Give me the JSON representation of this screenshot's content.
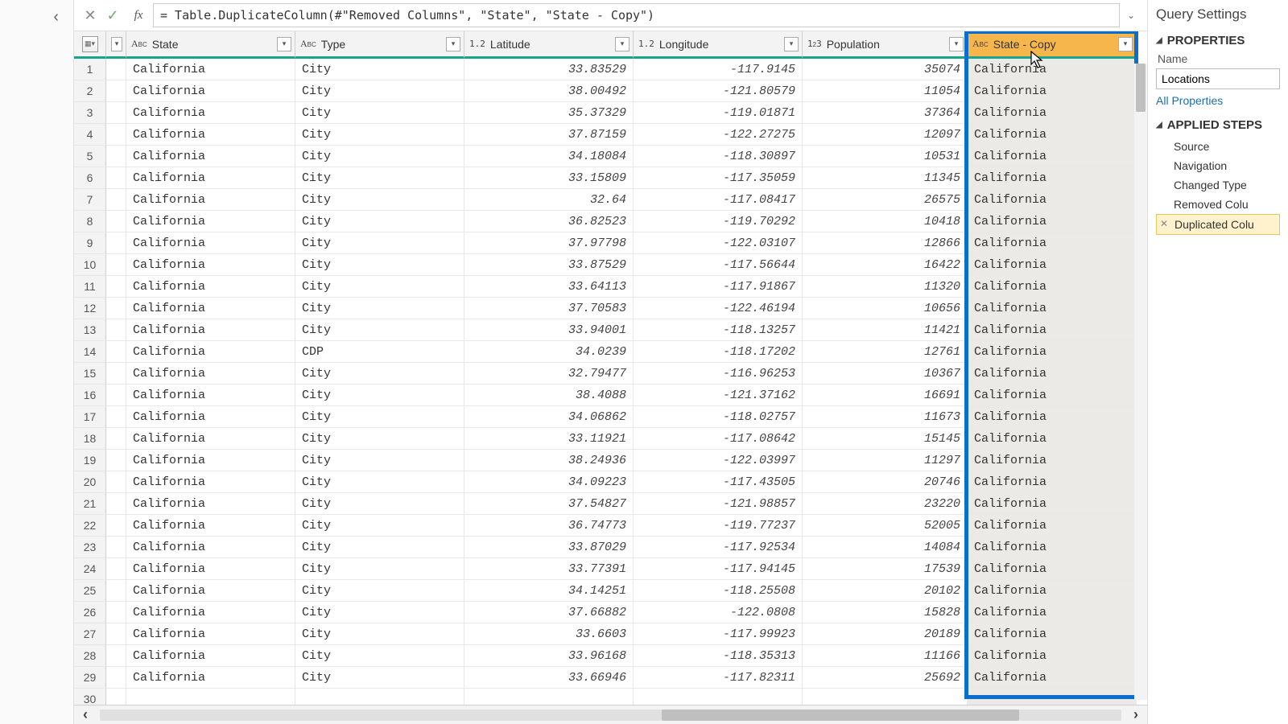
{
  "formula_bar": {
    "formula": "= Table.DuplicateColumn(#\"Removed Columns\", \"State\", \"State - Copy\")"
  },
  "columns": [
    {
      "name": "State",
      "type": "text",
      "sel": false
    },
    {
      "name": "Type",
      "type": "text",
      "sel": false
    },
    {
      "name": "Latitude",
      "type": "dec",
      "sel": false
    },
    {
      "name": "Longitude",
      "type": "dec",
      "sel": false
    },
    {
      "name": "Population",
      "type": "int",
      "sel": false
    },
    {
      "name": "State - Copy",
      "type": "text",
      "sel": true
    }
  ],
  "rows": [
    {
      "n": 1,
      "state": "California",
      "type": "City",
      "lat": "33.83529",
      "lon": "-117.9145",
      "pop": "35074",
      "copy": "California"
    },
    {
      "n": 2,
      "state": "California",
      "type": "City",
      "lat": "38.00492",
      "lon": "-121.80579",
      "pop": "11054",
      "copy": "California"
    },
    {
      "n": 3,
      "state": "California",
      "type": "City",
      "lat": "35.37329",
      "lon": "-119.01871",
      "pop": "37364",
      "copy": "California"
    },
    {
      "n": 4,
      "state": "California",
      "type": "City",
      "lat": "37.87159",
      "lon": "-122.27275",
      "pop": "12097",
      "copy": "California"
    },
    {
      "n": 5,
      "state": "California",
      "type": "City",
      "lat": "34.18084",
      "lon": "-118.30897",
      "pop": "10531",
      "copy": "California"
    },
    {
      "n": 6,
      "state": "California",
      "type": "City",
      "lat": "33.15809",
      "lon": "-117.35059",
      "pop": "11345",
      "copy": "California"
    },
    {
      "n": 7,
      "state": "California",
      "type": "City",
      "lat": "32.64",
      "lon": "-117.08417",
      "pop": "26575",
      "copy": "California"
    },
    {
      "n": 8,
      "state": "California",
      "type": "City",
      "lat": "36.82523",
      "lon": "-119.70292",
      "pop": "10418",
      "copy": "California"
    },
    {
      "n": 9,
      "state": "California",
      "type": "City",
      "lat": "37.97798",
      "lon": "-122.03107",
      "pop": "12866",
      "copy": "California"
    },
    {
      "n": 10,
      "state": "California",
      "type": "City",
      "lat": "33.87529",
      "lon": "-117.56644",
      "pop": "16422",
      "copy": "California"
    },
    {
      "n": 11,
      "state": "California",
      "type": "City",
      "lat": "33.64113",
      "lon": "-117.91867",
      "pop": "11320",
      "copy": "California"
    },
    {
      "n": 12,
      "state": "California",
      "type": "City",
      "lat": "37.70583",
      "lon": "-122.46194",
      "pop": "10656",
      "copy": "California"
    },
    {
      "n": 13,
      "state": "California",
      "type": "City",
      "lat": "33.94001",
      "lon": "-118.13257",
      "pop": "11421",
      "copy": "California"
    },
    {
      "n": 14,
      "state": "California",
      "type": "CDP",
      "lat": "34.0239",
      "lon": "-118.17202",
      "pop": "12761",
      "copy": "California"
    },
    {
      "n": 15,
      "state": "California",
      "type": "City",
      "lat": "32.79477",
      "lon": "-116.96253",
      "pop": "10367",
      "copy": "California"
    },
    {
      "n": 16,
      "state": "California",
      "type": "City",
      "lat": "38.4088",
      "lon": "-121.37162",
      "pop": "16691",
      "copy": "California"
    },
    {
      "n": 17,
      "state": "California",
      "type": "City",
      "lat": "34.06862",
      "lon": "-118.02757",
      "pop": "11673",
      "copy": "California"
    },
    {
      "n": 18,
      "state": "California",
      "type": "City",
      "lat": "33.11921",
      "lon": "-117.08642",
      "pop": "15145",
      "copy": "California"
    },
    {
      "n": 19,
      "state": "California",
      "type": "City",
      "lat": "38.24936",
      "lon": "-122.03997",
      "pop": "11297",
      "copy": "California"
    },
    {
      "n": 20,
      "state": "California",
      "type": "City",
      "lat": "34.09223",
      "lon": "-117.43505",
      "pop": "20746",
      "copy": "California"
    },
    {
      "n": 21,
      "state": "California",
      "type": "City",
      "lat": "37.54827",
      "lon": "-121.98857",
      "pop": "23220",
      "copy": "California"
    },
    {
      "n": 22,
      "state": "California",
      "type": "City",
      "lat": "36.74773",
      "lon": "-119.77237",
      "pop": "52005",
      "copy": "California"
    },
    {
      "n": 23,
      "state": "California",
      "type": "City",
      "lat": "33.87029",
      "lon": "-117.92534",
      "pop": "14084",
      "copy": "California"
    },
    {
      "n": 24,
      "state": "California",
      "type": "City",
      "lat": "33.77391",
      "lon": "-117.94145",
      "pop": "17539",
      "copy": "California"
    },
    {
      "n": 25,
      "state": "California",
      "type": "City",
      "lat": "34.14251",
      "lon": "-118.25508",
      "pop": "20102",
      "copy": "California"
    },
    {
      "n": 26,
      "state": "California",
      "type": "City",
      "lat": "37.66882",
      "lon": "-122.0808",
      "pop": "15828",
      "copy": "California"
    },
    {
      "n": 27,
      "state": "California",
      "type": "City",
      "lat": "33.6603",
      "lon": "-117.99923",
      "pop": "20189",
      "copy": "California"
    },
    {
      "n": 28,
      "state": "California",
      "type": "City",
      "lat": "33.96168",
      "lon": "-118.35313",
      "pop": "11166",
      "copy": "California"
    },
    {
      "n": 29,
      "state": "California",
      "type": "City",
      "lat": "33.66946",
      "lon": "-117.82311",
      "pop": "25692",
      "copy": "California"
    },
    {
      "n": 30,
      "state": "",
      "type": "",
      "lat": "",
      "lon": "",
      "pop": "",
      "copy": ""
    }
  ],
  "settings": {
    "title": "Query Settings",
    "props_h": "PROPERTIES",
    "name_lbl": "Name",
    "name_val": "Locations",
    "all_props": "All Properties",
    "steps_h": "APPLIED STEPS",
    "steps": [
      {
        "label": "Source",
        "active": false
      },
      {
        "label": "Navigation",
        "active": false
      },
      {
        "label": "Changed Type",
        "active": false
      },
      {
        "label": "Removed Colu",
        "active": false
      },
      {
        "label": "Duplicated Colu",
        "active": true
      }
    ]
  }
}
